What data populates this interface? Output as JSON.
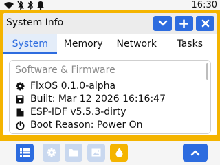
{
  "statusbar": {
    "icons": [
      "wifi-icon",
      "bluetooth-off-icon",
      "bluetooth-icon",
      "bell-icon"
    ],
    "time": "16:30"
  },
  "window": {
    "title": "System Info",
    "buttons": [
      "chevron-down-icon",
      "plus-icon",
      "close-icon"
    ]
  },
  "tabs": [
    {
      "label": "System",
      "active": true
    },
    {
      "label": "Memory",
      "active": false
    },
    {
      "label": "Network",
      "active": false
    },
    {
      "label": "Tasks",
      "active": false
    }
  ],
  "content": {
    "section_heading": "Software & Firmware",
    "rows": [
      {
        "icon": "gear-icon",
        "text": "FlxOS 0.1.0-alpha"
      },
      {
        "icon": "save-icon",
        "text": "Built: Mar 12 2026 16:16:47"
      },
      {
        "icon": "file-icon",
        "text": "ESP-IDF v5.5.3-dirty"
      },
      {
        "icon": "power-icon",
        "text": "Boot Reason: Power On"
      }
    ]
  },
  "taskbar": {
    "apps": [
      "list-icon",
      "gear-icon",
      "folder-icon",
      "image-icon",
      "drop-icon"
    ],
    "up_button": "chevron-up-icon"
  },
  "colors": {
    "accent": "#f4b400",
    "primary": "#2d6cdf",
    "background": "#f5f5f5"
  }
}
